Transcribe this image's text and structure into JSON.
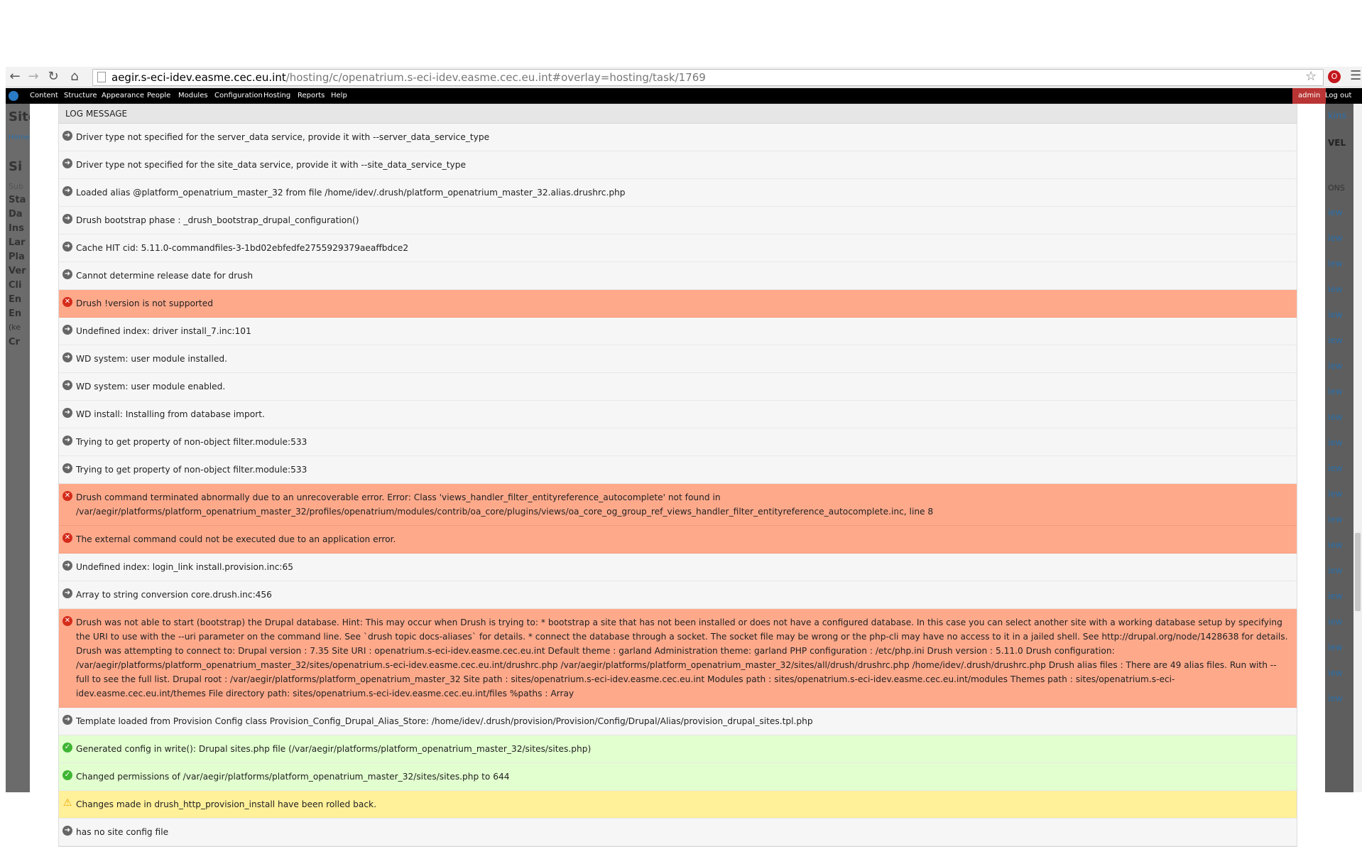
{
  "browser": {
    "url_host": "aegir.s-eci-idev.easme.cec.eu.int",
    "url_path": "/hosting/c/openatrium.s-eci-idev.easme.cec.eu.int#overlay=hosting/task/1769"
  },
  "toolbar": {
    "items": [
      "Content",
      "Structure",
      "Appearance",
      "People",
      "Modules",
      "Configuration",
      "Hosting",
      "Reports",
      "Help"
    ],
    "user": "admin",
    "logout": "Log out"
  },
  "background_left": [
    "Site",
    "Home",
    "Si",
    "Sub",
    "Sta",
    "Da",
    "Ins",
    "Lar",
    "Pla",
    "Ver",
    "Cli",
    "En",
    "En",
    "(ke",
    "Cr"
  ],
  "background_right": [
    "kins",
    "VEL",
    "ONS",
    "iew",
    "iew",
    "iew",
    "iew",
    "iew",
    "iew",
    "iew",
    "iew",
    "iew",
    "iew",
    "iew",
    "iew",
    "iew",
    "iew",
    "iew",
    "iew",
    "iew",
    "iew",
    "iew",
    "iew"
  ],
  "log": {
    "header": "LOG MESSAGE",
    "rows": [
      {
        "type": "info",
        "text": "Driver type not specified for the server_data service, provide it with --server_data_service_type"
      },
      {
        "type": "info",
        "text": "Driver type not specified for the site_data service, provide it with --site_data_service_type"
      },
      {
        "type": "info",
        "text": "Loaded alias @platform_openatrium_master_32 from file /home/idev/.drush/platform_openatrium_master_32.alias.drushrc.php"
      },
      {
        "type": "info",
        "text": "Drush bootstrap phase : _drush_bootstrap_drupal_configuration()"
      },
      {
        "type": "info",
        "text": "Cache HIT cid: 5.11.0-commandfiles-3-1bd02ebfedfe2755929379aeaffbdce2"
      },
      {
        "type": "info",
        "text": "Cannot determine release date for drush"
      },
      {
        "type": "error",
        "text": "Drush !version is not supported"
      },
      {
        "type": "info",
        "text": "Undefined index: driver install_7.inc:101"
      },
      {
        "type": "info",
        "text": "WD system: user module installed."
      },
      {
        "type": "info",
        "text": "WD system: user module enabled."
      },
      {
        "type": "info",
        "text": "WD install: Installing from database import."
      },
      {
        "type": "info",
        "text": "Trying to get property of non-object filter.module:533"
      },
      {
        "type": "info",
        "text": "Trying to get property of non-object filter.module:533"
      },
      {
        "type": "error",
        "text": "Drush command terminated abnormally due to an unrecoverable error. Error: Class 'views_handler_filter_entityreference_autocomplete' not found in /var/aegir/platforms/platform_openatrium_master_32/profiles/openatrium/modules/contrib/oa_core/plugins/views/oa_core_og_group_ref_views_handler_filter_entityreference_autocomplete.inc, line 8"
      },
      {
        "type": "error",
        "text": "The external command could not be executed due to an application error."
      },
      {
        "type": "info",
        "text": "Undefined index: login_link install.provision.inc:65"
      },
      {
        "type": "info",
        "text": "Array to string conversion core.drush.inc:456"
      },
      {
        "type": "error",
        "text": "Drush was not able to start (bootstrap) the Drupal database. Hint: This may occur when Drush is trying to: * bootstrap a site that has not been installed or does not have a configured database. In this case you can select another site with a working database setup by specifying the URI to use with the --uri parameter on the command line. See `drush topic docs-aliases` for details. * connect the database through a socket. The socket file may be wrong or the php-cli may have no access to it in a jailed shell. See http://drupal.org/node/1428638 for details. Drush was attempting to connect to: Drupal version : 7.35 Site URI : openatrium.s-eci-idev.easme.cec.eu.int Default theme : garland Administration theme: garland PHP configuration : /etc/php.ini Drush version : 5.11.0 Drush configuration: /var/aegir/platforms/platform_openatrium_master_32/sites/openatrium.s-eci-idev.easme.cec.eu.int/drushrc.php /var/aegir/platforms/platform_openatrium_master_32/sites/all/drush/drushrc.php /home/idev/.drush/drushrc.php Drush alias files : There are 49 alias files. Run with --full to see the full list. Drupal root : /var/aegir/platforms/platform_openatrium_master_32 Site path : sites/openatrium.s-eci-idev.easme.cec.eu.int Modules path : sites/openatrium.s-eci-idev.easme.cec.eu.int/modules Themes path : sites/openatrium.s-eci-idev.easme.cec.eu.int/themes File directory path: sites/openatrium.s-eci-idev.easme.cec.eu.int/files %paths : Array"
      },
      {
        "type": "info",
        "text": "Template loaded from Provision Config class Provision_Config_Drupal_Alias_Store: /home/idev/.drush/provision/Provision/Config/Drupal/Alias/provision_drupal_sites.tpl.php"
      },
      {
        "type": "success",
        "text": "Generated config in write(): Drupal sites.php file (/var/aegir/platforms/platform_openatrium_master_32/sites/sites.php)"
      },
      {
        "type": "success",
        "text": "Changed permissions of /var/aegir/platforms/platform_openatrium_master_32/sites/sites.php to 644"
      },
      {
        "type": "warning",
        "text": "Changes made in drush_http_provision_install have been rolled back."
      },
      {
        "type": "info",
        "text": "has no site config file"
      }
    ]
  }
}
